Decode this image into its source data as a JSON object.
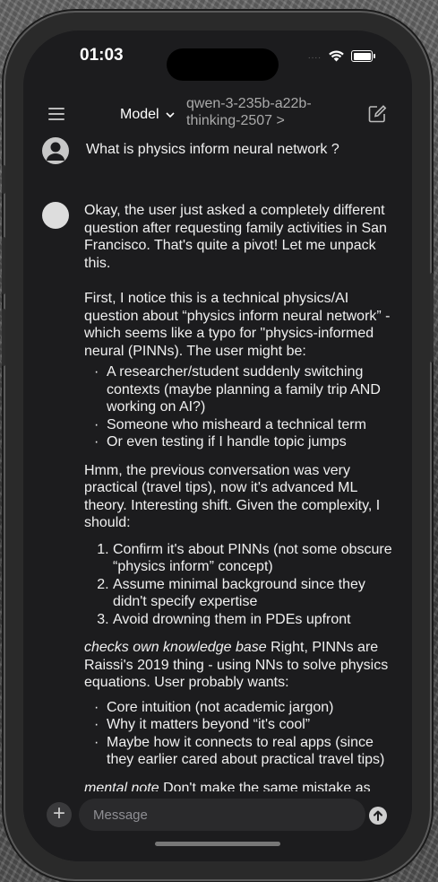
{
  "status": {
    "time": "01:03",
    "signal": "...."
  },
  "header": {
    "model_label": "Model",
    "model_name": "qwen-3-235b-a22b-thinking-2507 >"
  },
  "conversation": {
    "user_message": "What is physics inform neural network ?",
    "paragraphs": [
      "Okay, the user just asked a completely different question after requesting family activities in San Francisco. That's quite a pivot! Let me unpack this.",
      "First, I notice this is a technical physics/AI question about “physics inform neural network” - which seems like a typo for \"physics-informed neural (PINNs). The user might be:",
      "Hmm, the previous conversation was very practical (travel tips), now it's advanced ML theory. Interesting shift. Given the complexity, I should:",
      "Right, PINNs are Raissi's 2019 thing - using NNs to solve physics equations. User probably wants:",
      "Don't make the same mistake as their typo - say “physics-informed” not “physics"
    ],
    "italic_lead_1": "checks own knowledge base",
    "italic_lead_2": "mental note",
    "list1": [
      "A researcher/student suddenly switching contexts (maybe planning a family trip AND working on AI?)",
      "Someone who misheard a technical term",
      "Or even testing if I handle topic jumps"
    ],
    "list2": [
      "Confirm it's about PINNs (not some obscure “physics inform” concept)",
      "Assume minimal background since they didn't specify expertise",
      "Avoid drowning them in PDEs upfront"
    ],
    "list3": [
      "Core intuition (not academic jargon)",
      "Why it matters beyond “it's cool”",
      "Maybe how it connects to real apps (since they earlier cared about practical travel tips)"
    ]
  },
  "input": {
    "placeholder": "Message",
    "plus": "+"
  }
}
